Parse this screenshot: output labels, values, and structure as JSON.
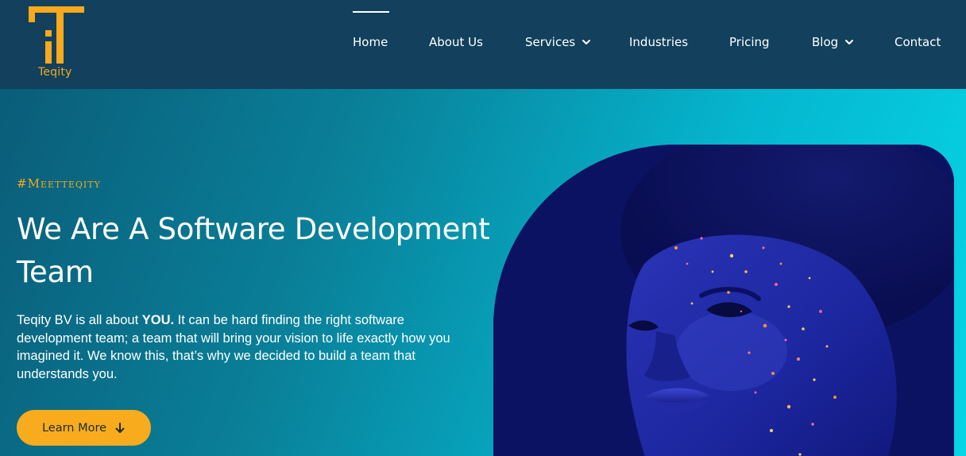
{
  "brand": {
    "name": "Teqity",
    "accent_color": "#f8a91c",
    "header_bg": "#12405d"
  },
  "nav": {
    "items": [
      {
        "label": "Home",
        "active": true,
        "dropdown": false
      },
      {
        "label": "About Us",
        "active": false,
        "dropdown": false
      },
      {
        "label": "Services",
        "active": false,
        "dropdown": true
      },
      {
        "label": "Industries",
        "active": false,
        "dropdown": false
      },
      {
        "label": "Pricing",
        "active": false,
        "dropdown": false
      },
      {
        "label": "Blog",
        "active": false,
        "dropdown": true
      },
      {
        "label": "Contact",
        "active": false,
        "dropdown": false
      }
    ]
  },
  "hero": {
    "tagline": "#Meetteqity",
    "headline": "We Are A Software Development Team",
    "description_lead": "Teqity BV is all about ",
    "description_emphasis": "YOU.",
    "description_rest": "  It can be hard finding the right software development team; a team that will bring your vision to life exactly how you imagined it. We know this, that’s why we decided to build a team that understands you.",
    "cta_label": "Learn More",
    "cta_icon": "arrow-down-icon",
    "image_subject": "portrait-with-glitter-face"
  }
}
